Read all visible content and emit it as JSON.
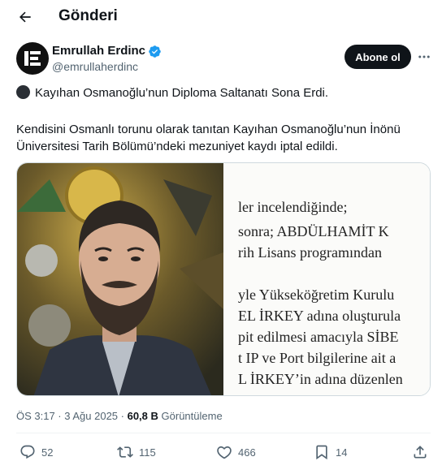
{
  "header": {
    "title": "Gönderi",
    "back_icon": "arrow-left-icon"
  },
  "author": {
    "name": "Emrullah Erdinc",
    "handle": "@emrullaherdinc",
    "verified": true,
    "avatar_icon": "ee-logo"
  },
  "follow_label": "Abone ol",
  "post": {
    "line1": "Kayıhan Osmanoğlu’nun Diploma Saltanatı Sona Erdi.",
    "line2": "Kendisini Osmanlı torunu olarak tanıtan Kayıhan Osmanoğlu’nun İnönü",
    "line3": "Üniversitesi Tarih Bölümü’ndeki mezuniyet kaydı iptal edildi."
  },
  "document_lines": [
    "ler incelendiğinde;",
    " sonra; ABDÜLHAMİT K",
    "rih Lisans programından",
    "yle Yükseköğretim Kurulu",
    "EL İRKEY adına oluşturula",
    "pit edilmesi amacıyla SİBE",
    "t IP ve Port bilgilerine ait a",
    "L İRKEY’in adına düzenlen"
  ],
  "meta": {
    "time": "ÖS 3:17 · 3 Ağu 2025 · ",
    "views": "60,8 B",
    "views_label": " Görüntüleme"
  },
  "actions": {
    "replies": "52",
    "reposts": "115",
    "likes": "466",
    "bookmarks": "14"
  },
  "colors": {
    "accent": "#1d9bf0",
    "text": "#0f1419",
    "muted": "#536471"
  }
}
